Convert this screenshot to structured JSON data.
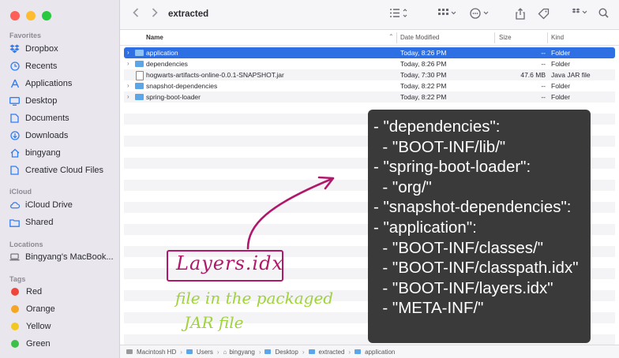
{
  "window": {
    "title": "extracted"
  },
  "sidebar": {
    "favorites_title": "Favorites",
    "favorites": [
      {
        "label": "Dropbox",
        "icon": "dropbox-icon"
      },
      {
        "label": "Recents",
        "icon": "clock-icon"
      },
      {
        "label": "Applications",
        "icon": "applications-icon"
      },
      {
        "label": "Desktop",
        "icon": "desktop-icon"
      },
      {
        "label": "Documents",
        "icon": "document-icon"
      },
      {
        "label": "Downloads",
        "icon": "download-icon"
      },
      {
        "label": "bingyang",
        "icon": "home-icon"
      },
      {
        "label": "Creative Cloud Files",
        "icon": "file-icon"
      }
    ],
    "icloud_title": "iCloud",
    "icloud": [
      {
        "label": "iCloud Drive",
        "icon": "cloud-icon"
      },
      {
        "label": "Shared",
        "icon": "shared-folder-icon"
      }
    ],
    "locations_title": "Locations",
    "locations": [
      {
        "label": "Bingyang's MacBook...",
        "icon": "laptop-icon"
      }
    ],
    "tags_title": "Tags",
    "tags": [
      {
        "label": "Red",
        "color": "#f0453a"
      },
      {
        "label": "Orange",
        "color": "#f5a623"
      },
      {
        "label": "Yellow",
        "color": "#f2c81f"
      },
      {
        "label": "Green",
        "color": "#3dbf4a"
      }
    ]
  },
  "columns": {
    "name": "Name",
    "date": "Date Modified",
    "size": "Size",
    "kind": "Kind"
  },
  "files": [
    {
      "name": "application",
      "date": "Today, 8:26 PM",
      "size": "--",
      "kind": "Folder",
      "type": "folder",
      "selected": true
    },
    {
      "name": "dependencies",
      "date": "Today, 8:26 PM",
      "size": "--",
      "kind": "Folder",
      "type": "folder",
      "selected": false
    },
    {
      "name": "hogwarts-artifacts-online-0.0.1-SNAPSHOT.jar",
      "date": "Today, 7:30 PM",
      "size": "47.6 MB",
      "kind": "Java JAR file",
      "type": "jar",
      "selected": false
    },
    {
      "name": "snapshot-dependencies",
      "date": "Today, 8:22 PM",
      "size": "--",
      "kind": "Folder",
      "type": "folder",
      "selected": false
    },
    {
      "name": "spring-boot-loader",
      "date": "Today, 8:22 PM",
      "size": "--",
      "kind": "Folder",
      "type": "folder",
      "selected": false
    }
  ],
  "pathbar": [
    "Macintosh HD",
    "Users",
    "bingyang",
    "Desktop",
    "extracted",
    "application"
  ],
  "overlay": {
    "lines": [
      "- \"dependencies\":",
      "  - \"BOOT-INF/lib/\"",
      "- \"spring-boot-loader\":",
      "  - \"org/\"",
      "- \"snapshot-dependencies\":",
      "- \"application\":",
      "  - \"BOOT-INF/classes/\"",
      "  - \"BOOT-INF/classpath.idx\"",
      "  - \"BOOT-INF/layers.idx\"",
      "  - \"META-INF/\""
    ]
  },
  "annotation": {
    "label": "Layers.idx",
    "note_line1": "file in the packaged",
    "note_line2": "JAR file",
    "label_color": "#b0186c",
    "note_color": "#9fd23b"
  }
}
